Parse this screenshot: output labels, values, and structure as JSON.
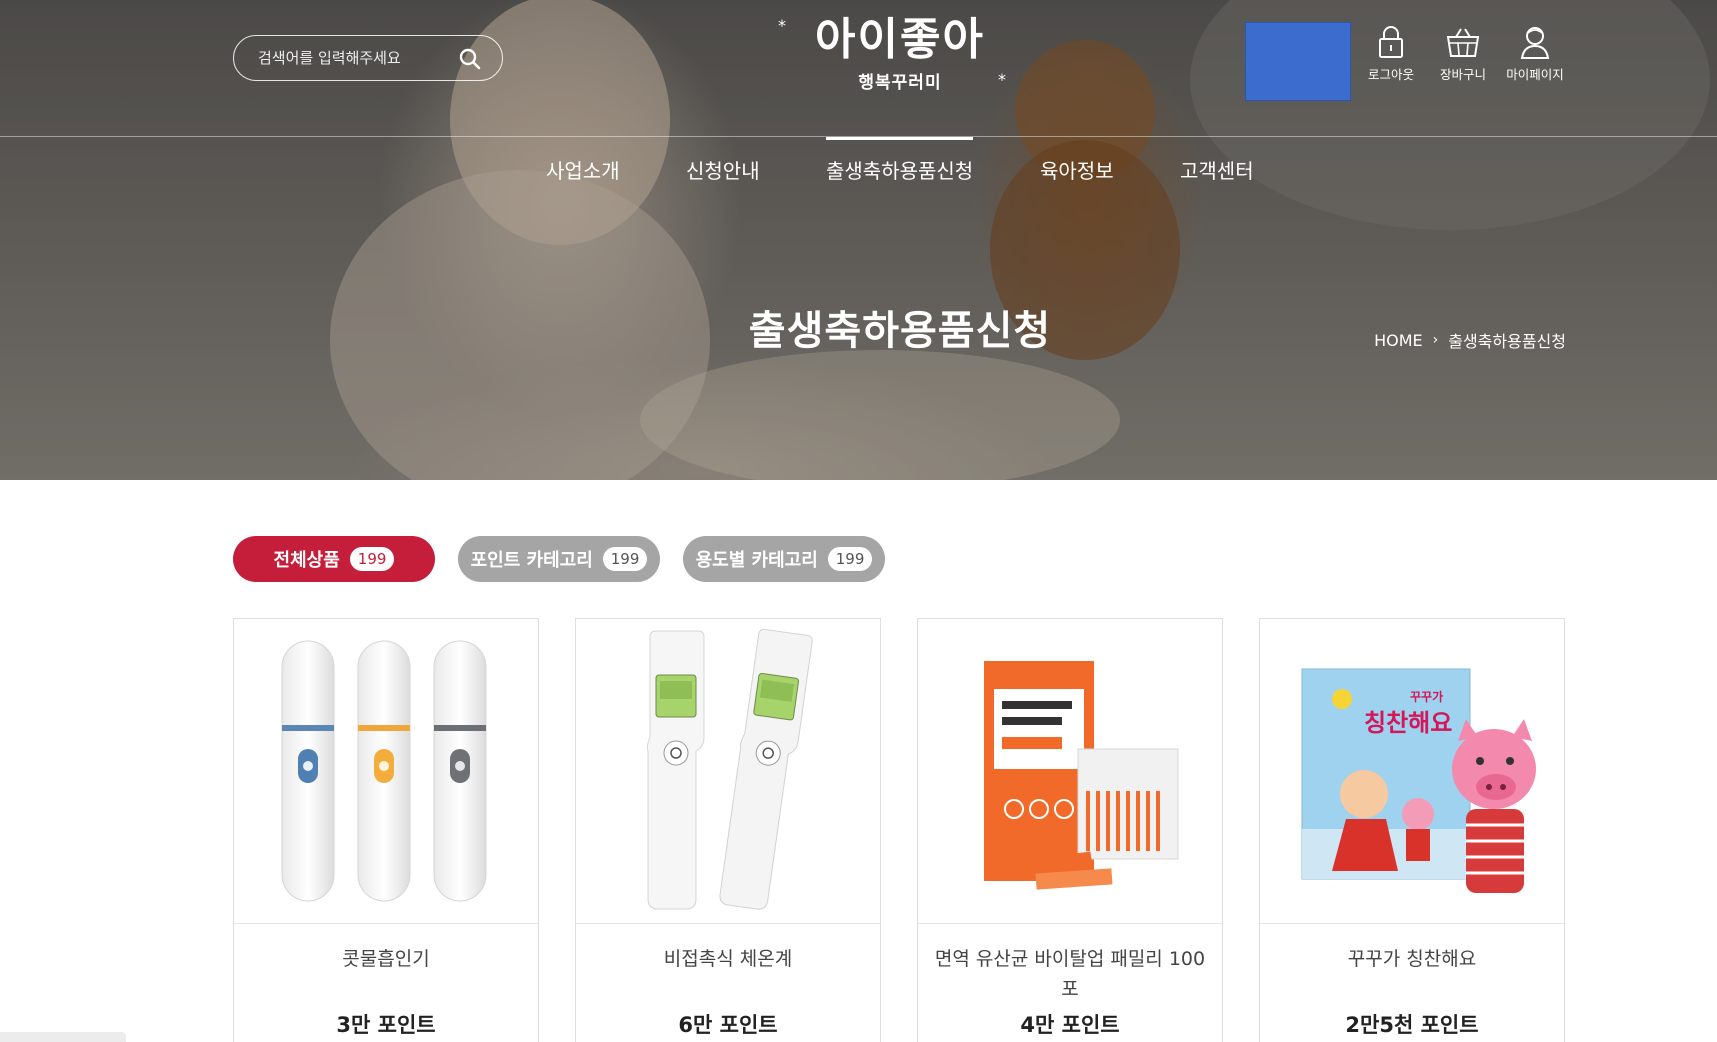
{
  "header": {
    "search": {
      "placeholder": "검색어를 입력해주세요",
      "icon": "search-icon"
    },
    "logo": {
      "main": "아이좋아",
      "sub": "행복꾸러미"
    },
    "utilities": [
      {
        "label": "로그아웃",
        "icon": "lock-icon"
      },
      {
        "label": "장바구니",
        "icon": "basket-icon"
      },
      {
        "label": "마이페이지",
        "icon": "user-icon"
      }
    ]
  },
  "gnb": {
    "items": [
      {
        "label": "사업소개"
      },
      {
        "label": "신청안내"
      },
      {
        "label": "출생축하용품신청",
        "active": true
      },
      {
        "label": "육아정보"
      },
      {
        "label": "고객센터"
      }
    ]
  },
  "page": {
    "title": "출생축하용품신청",
    "breadcrumb": {
      "home": "HOME",
      "separator": "›",
      "current": "출생축하용품신청"
    }
  },
  "tabs": [
    {
      "label": "전체상품",
      "count": "199",
      "active": true
    },
    {
      "label": "포인트 카테고리",
      "count": "199",
      "active": false
    },
    {
      "label": "용도별 카테고리",
      "count": "199",
      "active": false
    }
  ],
  "products": [
    {
      "name": "콧물흡인기",
      "points": "3만 포인트"
    },
    {
      "name": "비접촉식 체온계",
      "points": "6만 포인트"
    },
    {
      "name": "면역 유산균 바이탈업 패밀리 100포",
      "points": "4만 포인트"
    },
    {
      "name": "꾸꾸가 칭찬해요",
      "points": "2만5천 포인트"
    }
  ],
  "colors": {
    "accent": "#c41e3a",
    "tab_inactive": "#a5a5a5",
    "blue_box": "#3d6ccf"
  }
}
